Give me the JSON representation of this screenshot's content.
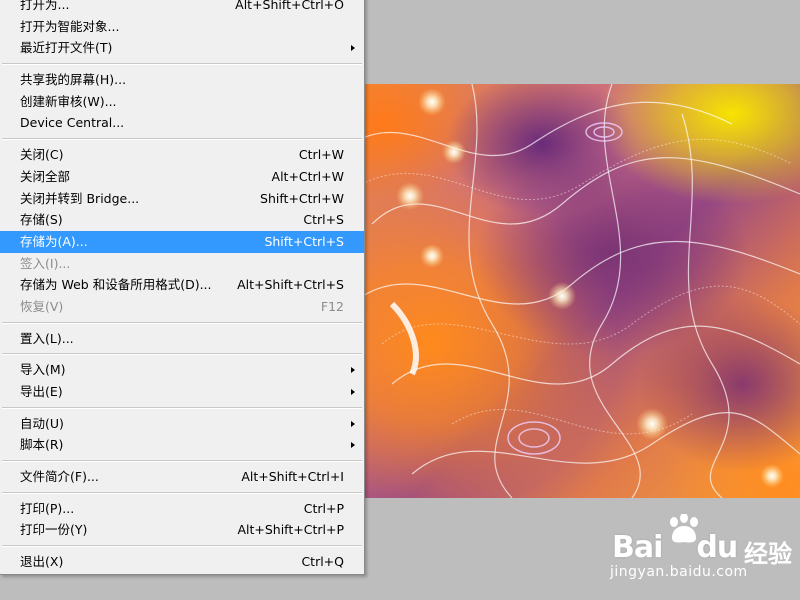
{
  "menu": {
    "groups": [
      [
        {
          "label": "打开为...",
          "shortcut": "Alt+Shift+Ctrl+O"
        },
        {
          "label": "打开为智能对象...",
          "shortcut": ""
        },
        {
          "label": "最近打开文件(T)",
          "shortcut": "",
          "submenu": true
        }
      ],
      [
        {
          "label": "共享我的屏幕(H)...",
          "shortcut": ""
        },
        {
          "label": "创建新审核(W)...",
          "shortcut": ""
        },
        {
          "label": "Device Central...",
          "shortcut": ""
        }
      ],
      [
        {
          "label": "关闭(C)",
          "shortcut": "Ctrl+W"
        },
        {
          "label": "关闭全部",
          "shortcut": "Alt+Ctrl+W"
        },
        {
          "label": "关闭并转到 Bridge...",
          "shortcut": "Shift+Ctrl+W"
        },
        {
          "label": "存储(S)",
          "shortcut": "Ctrl+S"
        },
        {
          "label": "存储为(A)...",
          "shortcut": "Shift+Ctrl+S",
          "selected": true
        },
        {
          "label": "签入(I)...",
          "shortcut": "",
          "disabled": true
        },
        {
          "label": "存储为 Web 和设备所用格式(D)...",
          "shortcut": "Alt+Shift+Ctrl+S"
        },
        {
          "label": "恢复(V)",
          "shortcut": "F12",
          "disabled": true
        }
      ],
      [
        {
          "label": "置入(L)...",
          "shortcut": ""
        }
      ],
      [
        {
          "label": "导入(M)",
          "shortcut": "",
          "submenu": true
        },
        {
          "label": "导出(E)",
          "shortcut": "",
          "submenu": true
        }
      ],
      [
        {
          "label": "自动(U)",
          "shortcut": "",
          "submenu": true
        },
        {
          "label": "脚本(R)",
          "shortcut": "",
          "submenu": true
        }
      ],
      [
        {
          "label": "文件简介(F)...",
          "shortcut": "Alt+Shift+Ctrl+I"
        }
      ],
      [
        {
          "label": "打印(P)...",
          "shortcut": "Ctrl+P"
        },
        {
          "label": "打印一份(Y)",
          "shortcut": "Alt+Shift+Ctrl+P"
        }
      ],
      [
        {
          "label": "退出(X)",
          "shortcut": "Ctrl+Q"
        }
      ]
    ]
  },
  "colors": {
    "menu_bg": "#f0f0f0",
    "selection": "#3399ff",
    "disabled_text": "#8c8c8c",
    "workspace": "#bdbdbd"
  },
  "watermark": {
    "brand": "Bai",
    "brand_suffix": "du",
    "product": "经验",
    "url": "jingyan.baidu.com",
    "icon": "paw-icon"
  }
}
